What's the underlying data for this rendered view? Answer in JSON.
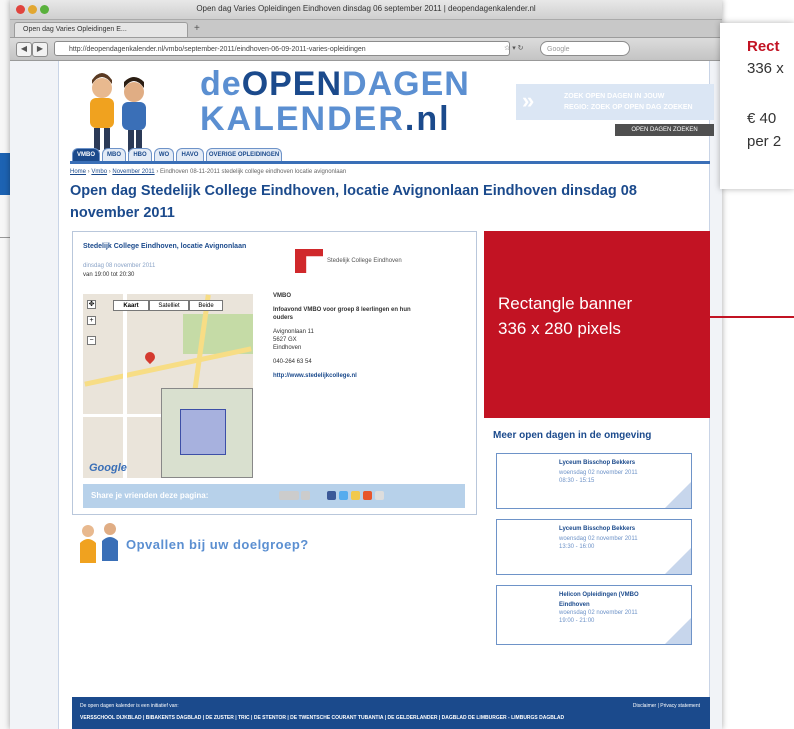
{
  "browser": {
    "window_title": "Open dag Varies Opleidingen Eindhoven dinsdag 06 september 2011 | deopendagenkalender.nl",
    "tab_label": "Open dag Varies Opleidingen E...",
    "address": "http://deopendagenkalender.nl/vmbo/september-2011/eindhoven-06-09-2011-varies-opleidingen",
    "search_placeholder": "Google"
  },
  "site": {
    "logo_de": "de",
    "logo_open": "OPEN",
    "logo_dagen": "DAGEN",
    "logo_kalender": "KALENDER",
    "logo_nl": ".nl",
    "header_banner_line1": "ZOEK OPEN DAGEN IN JOUW",
    "header_banner_line2": "REGIO: ZOEK OP OPEN DAG ZOEKEN",
    "search_button": "OPEN DAGEN ZOEKEN",
    "nav_tabs": [
      "VMBO",
      "MBO",
      "HBO",
      "WO",
      "HAVO",
      "OVERIGE OPLEIDINGEN"
    ],
    "breadcrumb": {
      "home": "Home",
      "vmbo": "Vmbo",
      "month": "November 2011",
      "rest": "› Eindhoven 08-11-2011 stedelijk college eindhoven locatie avignonlaan"
    },
    "page_title": "Open dag Stedelijk College Eindhoven, locatie Avignonlaan Eindhoven dinsdag 08 november 2011"
  },
  "school": {
    "name": "Stedelijk College Eindhoven, locatie Avignonlaan",
    "date": "dinsdag 08 november 2011",
    "time": "van 19:00 tot 20:30",
    "logo_text": "Stedelijk College Eindhoven",
    "level": "VMBO",
    "audience": "Infoavond VMBO voor groep 8 leerlingen en hun ouders",
    "street": "Avignonlaan 11",
    "postcode": "5627 GX",
    "city": "Eindhoven",
    "phone": "040-264 63 54",
    "url": "http://www.stedelijkcollege.nl",
    "map_buttons": [
      "Kaart",
      "Satelliet",
      "Beide"
    ],
    "google": "Google",
    "share_text": "Share je vrienden deze pagina:"
  },
  "red_banner": {
    "line1": "Rectangle banner",
    "line2": "336 x 280 pixels"
  },
  "sidebar": {
    "heading": "Meer open dagen in de omgeving",
    "events": [
      {
        "name": "Lyceum Bisschop Bekkers",
        "date": "woensdag 02 november 2011",
        "time": "08:30 - 15:15"
      },
      {
        "name": "Lyceum Bisschop Bekkers",
        "date": "woensdag 02 november 2011",
        "time": "13:30 - 16:00"
      },
      {
        "name": "Helicon Opleidingen (VMBO",
        "date": "Eindhoven",
        "time": "woensdag 02 november 2011",
        "extra": "19:00 - 21:00"
      }
    ]
  },
  "promo": {
    "text": "Opvallen bij uw doelgroep?"
  },
  "footer": {
    "line1": "De open dagen kalender is een initiatief van:",
    "links": "Disclaimer | Privacy statement",
    "line2": "VERSSCHOOL DIJKBLAD | BIBAKENTS DAGBLAD | DE ZUSTER | TRIC | DE STENTOR | DE TWENTSCHE COURANT TUBANTIA | DE GELDERLANDER | DAGBLAD DE LIMBURGER - LIMBURGS DAGBLAD"
  },
  "callout": {
    "title": "Rect",
    "size": "336 x",
    "price": "€ 40",
    "period": "per 2"
  },
  "colors": {
    "brand_blue": "#1b4a8c",
    "light_blue": "#5b8fd1",
    "banner_red": "#c21323"
  }
}
